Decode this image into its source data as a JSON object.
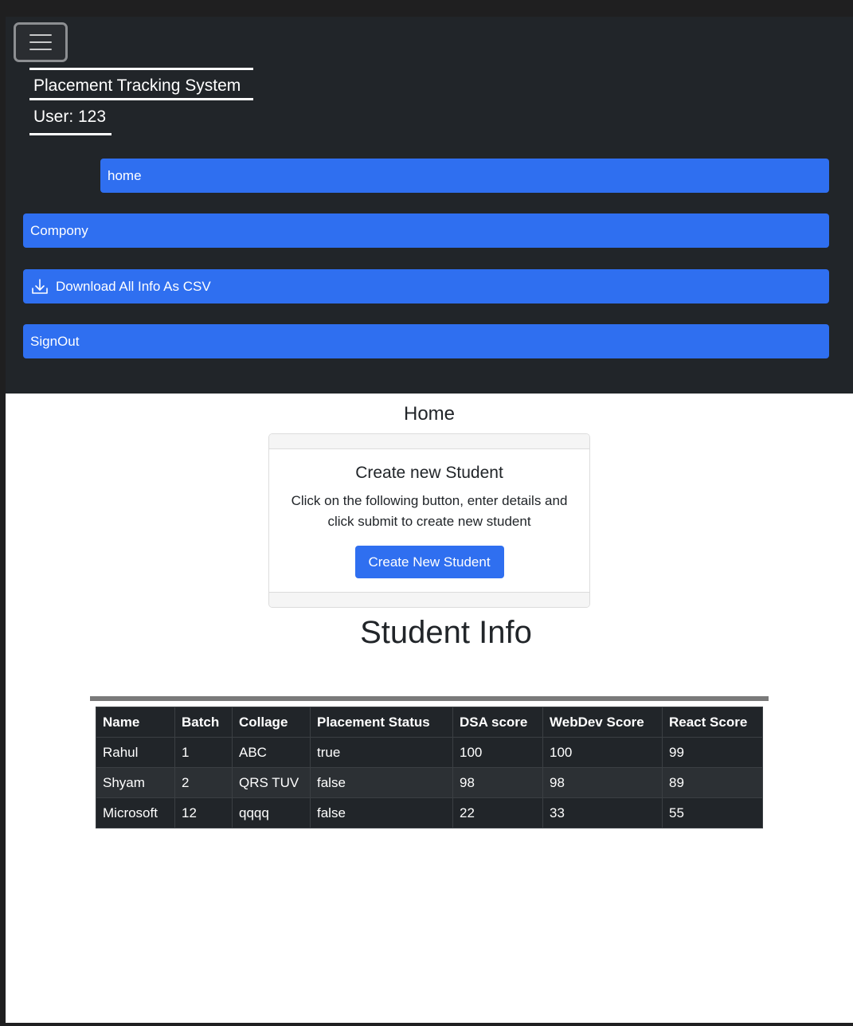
{
  "navbar": {
    "brand": "Placement Tracking System",
    "user": "User: 123",
    "items": [
      {
        "label": "home"
      },
      {
        "label": "Compony"
      },
      {
        "label": "Download All Info As CSV",
        "icon": "download-icon"
      },
      {
        "label": "SignOut"
      }
    ]
  },
  "main": {
    "title": "Home",
    "card": {
      "title": "Create new Student",
      "text": "Click on the following button, enter details and click submit to create new student",
      "button": "Create New Student"
    },
    "student_info_title": "Student Info",
    "table": {
      "headers": [
        "Name",
        "Batch",
        "Collage",
        "Placement Status",
        "DSA score",
        "WebDev Score",
        "React Score"
      ],
      "rows": [
        [
          "Rahul",
          "1",
          "ABC",
          "true",
          "100",
          "100",
          "99"
        ],
        [
          "Shyam",
          "2",
          "QRS TUV",
          "false",
          "98",
          "98",
          "89"
        ],
        [
          "Microsoft",
          "12",
          "qqqq",
          "false",
          "22",
          "33",
          "55"
        ]
      ]
    }
  },
  "colors": {
    "navbar_bg": "#212529",
    "primary": "#2f6ff0",
    "table_bg": "#212529"
  }
}
